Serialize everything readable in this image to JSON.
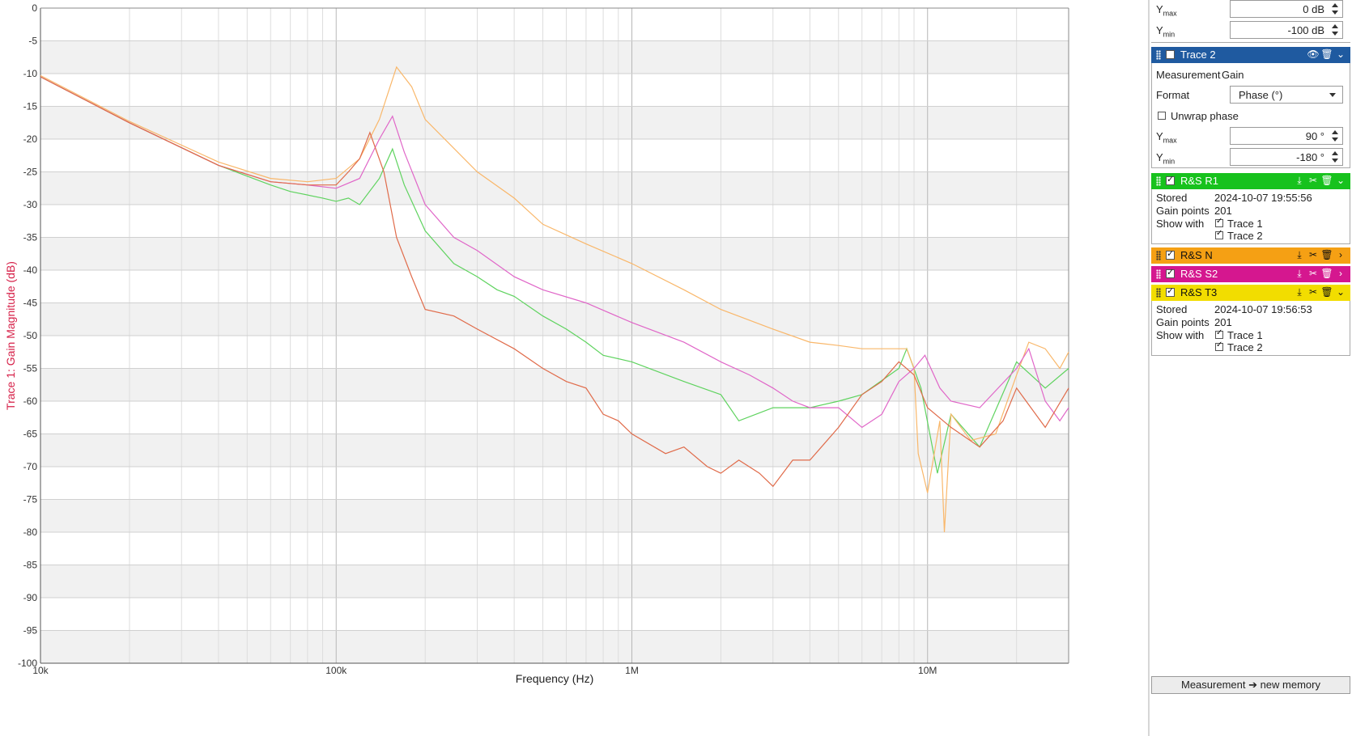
{
  "chart_data": {
    "type": "line",
    "xlabel": "Frequency (Hz)",
    "ylabel": "Trace 1: Gain Magnitude (dB)",
    "xscale": "log",
    "xlim": [
      10000,
      30000000
    ],
    "ylim": [
      -100,
      0
    ],
    "grid": true,
    "x_tick_labels": [
      "10k",
      "100k",
      "1M",
      "10M"
    ],
    "x_ticks": [
      10000,
      100000,
      1000000,
      10000000
    ],
    "y_ticks": [
      0,
      -5,
      -10,
      -15,
      -20,
      -25,
      -30,
      -35,
      -40,
      -45,
      -50,
      -55,
      -60,
      -65,
      -70,
      -75,
      -80,
      -85,
      -90,
      -95,
      -100
    ],
    "series": [
      {
        "name": "R&S R1",
        "color": "#5fd35f",
        "x": [
          10000,
          20000,
          40000,
          60000,
          70000,
          90000,
          100000,
          110000,
          120000,
          140000,
          155000,
          170000,
          200000,
          250000,
          300000,
          350000,
          400000,
          500000,
          600000,
          700000,
          800000,
          1000000,
          1500000,
          2000000,
          2300000,
          3000000,
          4000000,
          5000000,
          6000000,
          8000000,
          8500000,
          9500000,
          10800000,
          12000000,
          15000000,
          20000000,
          25000000,
          30000000
        ],
        "y": [
          -10.5,
          -17.5,
          -24,
          -27,
          -28,
          -29,
          -29.5,
          -29,
          -30,
          -26,
          -21.5,
          -27,
          -34,
          -39,
          -41,
          -43,
          -44,
          -47,
          -49,
          -51,
          -53,
          -54,
          -57,
          -59,
          -63,
          -61,
          -61,
          -60,
          -59,
          -55,
          -52,
          -58,
          -71,
          -62,
          -67,
          -54,
          -58,
          -55
        ]
      },
      {
        "name": "R&S N",
        "color": "#f9b76a",
        "x": [
          10000,
          20000,
          40000,
          60000,
          80000,
          100000,
          120000,
          140000,
          160000,
          180000,
          200000,
          300000,
          400000,
          500000,
          700000,
          1000000,
          1500000,
          2000000,
          3000000,
          4000000,
          5000000,
          6000000,
          7000000,
          8000000,
          8500000,
          9000000,
          9300000,
          10000000,
          11000000,
          11400000,
          12000000,
          14000000,
          17000000,
          20000000,
          22000000,
          25000000,
          28000000,
          30000000
        ],
        "y": [
          -10.3,
          -17.3,
          -23.5,
          -26,
          -26.5,
          -26,
          -23,
          -17,
          -9,
          -12,
          -17,
          -25,
          -29,
          -33,
          -36,
          -39,
          -43,
          -46,
          -49,
          -51,
          -51.5,
          -52,
          -52,
          -52,
          -52,
          -55,
          -68,
          -74,
          -63,
          -80,
          -62,
          -66,
          -65,
          -56,
          -51,
          -52,
          -55,
          -52.5
        ]
      },
      {
        "name": "R&S S2",
        "color": "#e066c8",
        "x": [
          10000,
          20000,
          40000,
          60000,
          80000,
          100000,
          120000,
          140000,
          155000,
          170000,
          200000,
          250000,
          300000,
          400000,
          500000,
          700000,
          1000000,
          1500000,
          2000000,
          2500000,
          3000000,
          3500000,
          4000000,
          5000000,
          6000000,
          7000000,
          8000000,
          9000000,
          9800000,
          11000000,
          12000000,
          15000000,
          20000000,
          22000000,
          25000000,
          28000000,
          30000000
        ],
        "y": [
          -10.5,
          -17.5,
          -24,
          -26.5,
          -27,
          -27.5,
          -26,
          -20,
          -16.5,
          -22,
          -30,
          -35,
          -37,
          -41,
          -43,
          -45,
          -48,
          -51,
          -54,
          -56,
          -58,
          -60,
          -61,
          -61,
          -64,
          -62,
          -57,
          -55,
          -53,
          -58,
          -60,
          -61,
          -55,
          -52,
          -60,
          -63,
          -61
        ]
      },
      {
        "name": "R&S T3",
        "color": "#e06b4a",
        "x": [
          10000,
          20000,
          40000,
          60000,
          80000,
          100000,
          110000,
          120000,
          130000,
          145000,
          160000,
          180000,
          200000,
          250000,
          300000,
          400000,
          500000,
          600000,
          700000,
          800000,
          900000,
          1000000,
          1300000,
          1500000,
          1800000,
          2000000,
          2300000,
          2700000,
          3000000,
          3500000,
          4000000,
          5000000,
          6000000,
          7000000,
          8000000,
          9000000,
          10000000,
          12000000,
          15000000,
          18000000,
          20000000,
          25000000,
          30000000
        ],
        "y": [
          -10.5,
          -17.5,
          -24,
          -26.5,
          -27,
          -27,
          -25,
          -23,
          -19,
          -25,
          -35,
          -41,
          -46,
          -47,
          -49,
          -52,
          -55,
          -57,
          -58,
          -62,
          -63,
          -65,
          -68,
          -67,
          -70,
          -71,
          -69,
          -71,
          -73,
          -69,
          -69,
          -64,
          -59,
          -57,
          -54,
          -56,
          -61,
          -64,
          -67,
          -63,
          -58,
          -64,
          -58
        ]
      }
    ]
  },
  "sidebar": {
    "top": {
      "ymax_label": "Y",
      "ymax_sub": "max",
      "ymax_value": "0 dB",
      "ymin_label": "Y",
      "ymin_sub": "min",
      "ymin_value": "-100 dB"
    },
    "trace2": {
      "title": "Trace 2",
      "color": "#1f5aa0",
      "measurement_label": "Measurement",
      "measurement_value": "Gain",
      "format_label": "Format",
      "format_value": "Phase (°)",
      "unwrap_label": "Unwrap phase",
      "ymax_label": "Y",
      "ymax_sub": "max",
      "ymax_value": "90 °",
      "ymin_label": "Y",
      "ymin_sub": "min",
      "ymin_value": "-180 °"
    },
    "memories": [
      {
        "title": "R&S R1",
        "color": "#17c21d",
        "stored_label": "Stored",
        "stored_value": "2024-10-07 19:55:56",
        "points_label": "Gain points",
        "points_value": "201",
        "show_label": "Show with",
        "trace1": "Trace 1",
        "trace2": "Trace 2"
      },
      {
        "title": "R&S N",
        "color": "#f5a014"
      },
      {
        "title": "R&S S2",
        "color": "#d5178f"
      },
      {
        "title": "R&S T3",
        "color": "#f2dd00",
        "stored_label": "Stored",
        "stored_value": "2024-10-07 19:56:53",
        "points_label": "Gain points",
        "points_value": "201",
        "show_label": "Show with",
        "trace1": "Trace 1",
        "trace2": "Trace 2"
      }
    ],
    "new_memory_button": "Measurement ➔ new memory"
  }
}
